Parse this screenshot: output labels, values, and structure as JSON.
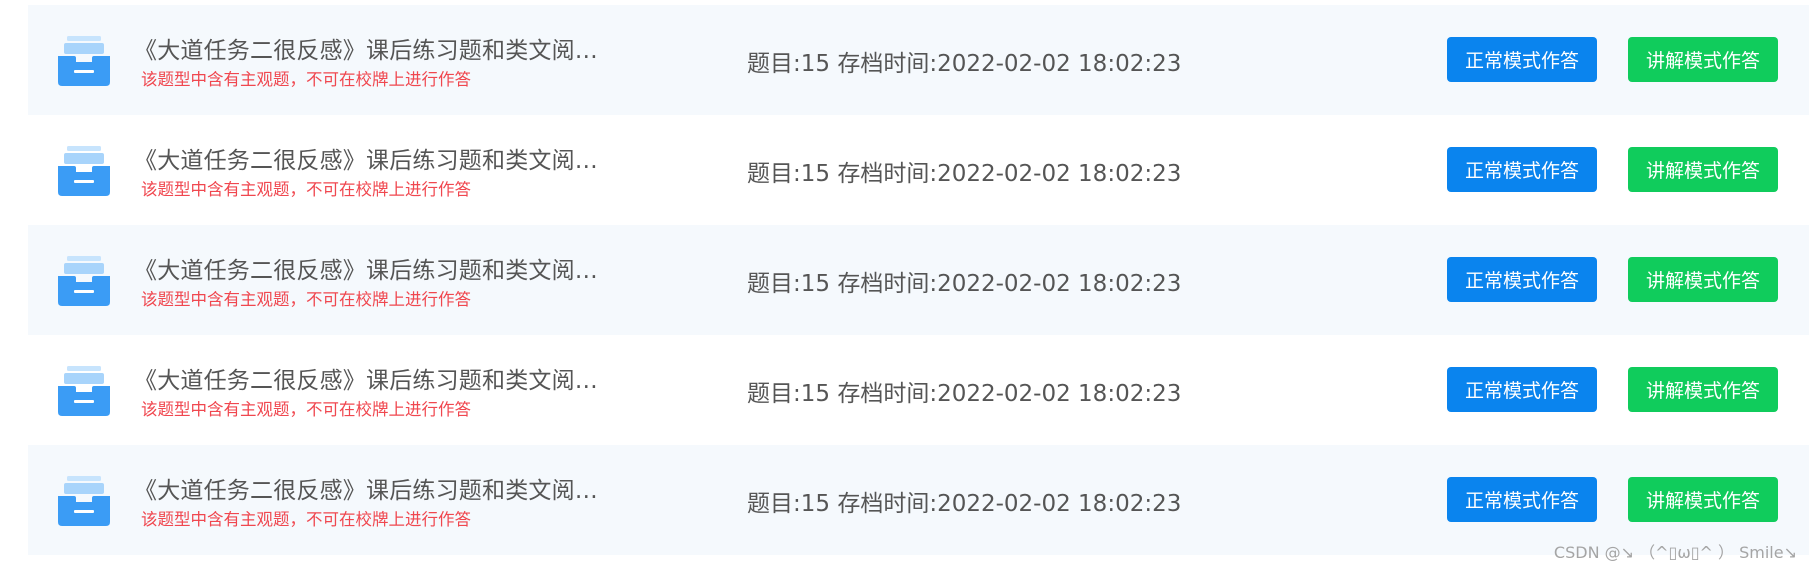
{
  "rows": [
    {
      "title": "《大道任务二很反感》课后练习题和类文阅…",
      "warning": "该题型中含有主观题，不可在校牌上进行作答",
      "meta": "题目:15 存档时间:2022-02-02 18:02:23",
      "normal_button": "正常模式作答",
      "explain_button": "讲解模式作答"
    },
    {
      "title": "《大道任务二很反感》课后练习题和类文阅…",
      "warning": "该题型中含有主观题，不可在校牌上进行作答",
      "meta": "题目:15 存档时间:2022-02-02 18:02:23",
      "normal_button": "正常模式作答",
      "explain_button": "讲解模式作答"
    },
    {
      "title": "《大道任务二很反感》课后练习题和类文阅…",
      "warning": "该题型中含有主观题，不可在校牌上进行作答",
      "meta": "题目:15 存档时间:2022-02-02 18:02:23",
      "normal_button": "正常模式作答",
      "explain_button": "讲解模式作答"
    },
    {
      "title": "《大道任务二很反感》课后练习题和类文阅…",
      "warning": "该题型中含有主观题，不可在校牌上进行作答",
      "meta": "题目:15 存档时间:2022-02-02 18:02:23",
      "normal_button": "正常模式作答",
      "explain_button": "讲解模式作答"
    },
    {
      "title": "《大道任务二很反感》课后练习题和类文阅…",
      "warning": "该题型中含有主观题，不可在校牌上进行作答",
      "meta": "题目:15 存档时间:2022-02-02 18:02:23",
      "normal_button": "正常模式作答",
      "explain_button": "讲解模式作答"
    }
  ],
  "icon": "inbox-tray-icon",
  "colors": {
    "row_alt_bg": "#f5f9fd",
    "title_text": "#555555",
    "warning_text": "#f0474f",
    "normal_button": "#0a84ee",
    "explain_button": "#10cc5c",
    "icon_primary": "#3b9cf5",
    "icon_light": "#a8d4fb"
  },
  "watermark": "CSDN @↘ （^▯ω▯^ ） Smile↘"
}
